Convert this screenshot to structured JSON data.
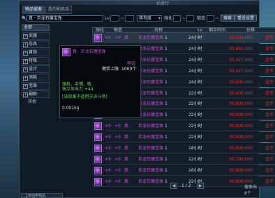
{
  "window": {
    "title": "拍卖行"
  },
  "tabs": [
    {
      "label": "物品搜索"
    },
    {
      "label": "我的拍卖品"
    }
  ],
  "search": {
    "query": "真 · 巨龙石魔宝珠",
    "levelLabel": "Lv",
    "quality": "稀有度",
    "enhanceLabel": "强化",
    "refineLabel": "锻造",
    "searchButton": "搜索",
    "resetButton": "重设设置"
  },
  "sidebar": {
    "header": "全部",
    "categories": [
      "武器",
      "防具",
      "首饰",
      "特殊",
      "设计",
      "消耗",
      "宝珠",
      "副职"
    ],
    "other": "其他"
  },
  "table": {
    "columns": [
      "强化",
      "锻造",
      "名称",
      "Lv",
      "剩余时间",
      "价格"
    ],
    "rows": [
      {
        "str": "+0",
        "enh": "+0",
        "q": "真",
        "name": "巨龙石魔宝珠",
        "lv": "1",
        "time": "24小时",
        "price": "30,000,000",
        "unit": "金币"
      },
      {
        "str": "+0",
        "enh": "+0",
        "q": "真",
        "name": "巨龙石魔宝珠",
        "lv": "1",
        "time": "24小时",
        "price": "30,060,000",
        "unit": "金币"
      },
      {
        "str": "+0",
        "enh": "+0",
        "q": "真",
        "name": "巨龙石魔宝珠",
        "lv": "1",
        "time": "24小时",
        "price": "30,427,000",
        "unit": "金币"
      },
      {
        "str": "+0",
        "enh": "+0",
        "q": "真",
        "name": "巨龙石魔宝珠",
        "lv": "1",
        "time": "24小时",
        "price": "30,427,000",
        "unit": "金币"
      },
      {
        "str": "+0",
        "enh": "+0",
        "q": "真",
        "name": "巨龙石魔宝珠",
        "lv": "1",
        "time": "24小时",
        "price": "30,600,000",
        "unit": "金币"
      },
      {
        "str": "+0",
        "enh": "+0",
        "q": "真",
        "name": "巨龙石魔宝珠",
        "lv": "1",
        "time": "22小时",
        "price": "30,600,000",
        "unit": "金币"
      },
      {
        "str": "+0",
        "enh": "+0",
        "q": "真",
        "name": "巨龙石魔宝珠",
        "lv": "1",
        "time": "22小时",
        "price": "30,600,000",
        "unit": "金币"
      },
      {
        "str": "+0",
        "enh": "+0",
        "q": "真",
        "name": "巨龙石魔宝珠",
        "lv": "1",
        "time": "22小时",
        "price": "30,600,000",
        "unit": "金币"
      },
      {
        "str": "+0",
        "enh": "+0",
        "q": "真",
        "name": "巨龙石魔宝珠",
        "lv": "1",
        "time": "22小时",
        "price": "30,600,000",
        "unit": "金币"
      },
      {
        "str": "+0",
        "enh": "+0",
        "q": "真",
        "name": "巨龙石魔宝珠",
        "lv": "1",
        "time": "22小时",
        "price": "30,600,000",
        "unit": "金币"
      },
      {
        "str": "+0",
        "enh": "+0",
        "q": "真",
        "name": "巨龙石魔宝珠",
        "lv": "1",
        "time": "18小时",
        "price": "30,600,000",
        "unit": "金币"
      },
      {
        "str": "+0",
        "enh": "+0",
        "q": "真",
        "name": "巨龙石魔宝珠",
        "lv": "1",
        "time": "12小时",
        "price": "30,700,000",
        "unit": "金币"
      },
      {
        "str": "+0",
        "enh": "+0",
        "q": "真",
        "name": "巨龙石魔宝珠",
        "lv": "1",
        "time": "16小时",
        "price": "30,800,000",
        "unit": "金币"
      },
      {
        "str": "+0",
        "enh": "+0",
        "q": "真",
        "name": "巨龙石魔宝珠",
        "lv": "1",
        "time": "22小时",
        "price": "30,800,000",
        "unit": "金币"
      }
    ]
  },
  "tooltip": {
    "name": "真 · 巨龙石魔宝珠",
    "type": "神话",
    "note": "携带上限",
    "cap": "1000个",
    "stat1": "頭肩、手镯、靴",
    "stat2": "独立攻击力 +44",
    "rule": "[该效果不适用于决斗场]",
    "weight": "0.001kg"
  },
  "pager": {
    "page": "1 / 2",
    "prev": "◀",
    "next": "▶"
  },
  "footer": {
    "left": "上架拍卖物品",
    "right": "搜索出8个"
  },
  "colors": {
    "rare": "#c34bd0",
    "price": "#e1283a"
  }
}
